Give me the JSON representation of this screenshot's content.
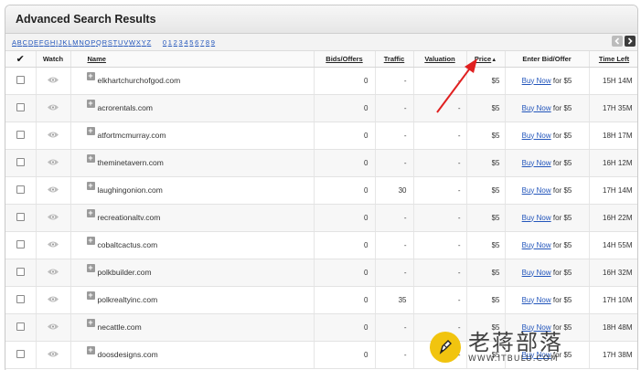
{
  "title": "Advanced Search Results",
  "alpha_nav": {
    "letters": [
      "A",
      "B",
      "C",
      "D",
      "E",
      "F",
      "G",
      "H",
      "I",
      "J",
      "K",
      "L",
      "M",
      "N",
      "O",
      "P",
      "Q",
      "R",
      "S",
      "T",
      "U",
      "V",
      "W",
      "X",
      "Y",
      "Z"
    ],
    "digits": [
      "0",
      "1",
      "2",
      "3",
      "4",
      "5",
      "6",
      "7",
      "8",
      "9"
    ]
  },
  "columns": {
    "check": "✔",
    "watch": "Watch",
    "name": "Name",
    "bids": "Bids/Offers",
    "traffic": "Traffic",
    "valuation": "Valuation",
    "price": "Price",
    "offer": "Enter Bid/Offer",
    "time": "Time Left"
  },
  "buy_label": "Buy Now",
  "rows": [
    {
      "name": "elkhartchurchofgod.com",
      "bids": "0",
      "traffic": "-",
      "valuation": "-",
      "price": "$5",
      "offer_suffix": "for $5",
      "time": "15H 14M"
    },
    {
      "name": "acrorentals.com",
      "bids": "0",
      "traffic": "-",
      "valuation": "-",
      "price": "$5",
      "offer_suffix": "for $5",
      "time": "17H 35M"
    },
    {
      "name": "atfortmcmurray.com",
      "bids": "0",
      "traffic": "-",
      "valuation": "-",
      "price": "$5",
      "offer_suffix": "for $5",
      "time": "18H 17M"
    },
    {
      "name": "theminetavern.com",
      "bids": "0",
      "traffic": "-",
      "valuation": "-",
      "price": "$5",
      "offer_suffix": "for $5",
      "time": "16H 12M"
    },
    {
      "name": "laughingonion.com",
      "bids": "0",
      "traffic": "30",
      "valuation": "-",
      "price": "$5",
      "offer_suffix": "for $5",
      "time": "17H 14M"
    },
    {
      "name": "recreationaltv.com",
      "bids": "0",
      "traffic": "-",
      "valuation": "-",
      "price": "$5",
      "offer_suffix": "for $5",
      "time": "16H 22M"
    },
    {
      "name": "cobaltcactus.com",
      "bids": "0",
      "traffic": "-",
      "valuation": "-",
      "price": "$5",
      "offer_suffix": "for $5",
      "time": "14H 55M"
    },
    {
      "name": "polkbuilder.com",
      "bids": "0",
      "traffic": "-",
      "valuation": "-",
      "price": "$5",
      "offer_suffix": "for $5",
      "time": "16H 32M"
    },
    {
      "name": "polkrealtyinc.com",
      "bids": "0",
      "traffic": "35",
      "valuation": "-",
      "price": "$5",
      "offer_suffix": "for $5",
      "time": "17H 10M"
    },
    {
      "name": "necattle.com",
      "bids": "0",
      "traffic": "-",
      "valuation": "-",
      "price": "$5",
      "offer_suffix": "for $5",
      "time": "18H 48M"
    },
    {
      "name": "doosdesigns.com",
      "bids": "0",
      "traffic": "-",
      "valuation": "-",
      "price": "$5",
      "offer_suffix": "for $5",
      "time": "17H 38M"
    }
  ],
  "watermark": {
    "title": "老蒋部落",
    "url": "WWW.ITBULU.COM"
  },
  "colors": {
    "link": "#2255bb",
    "annotation_arrow": "#e02020",
    "watermark_logo": "#f1c40f"
  }
}
